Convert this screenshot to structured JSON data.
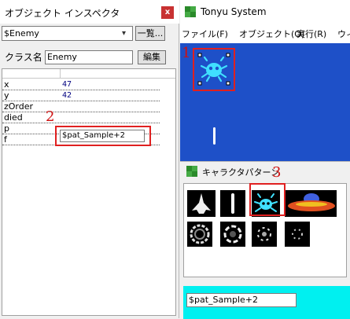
{
  "inspector": {
    "title": "オブジェクト インスペクタ",
    "close_label": "x",
    "object_select_value": "$Enemy",
    "list_button": "一覧...",
    "class_label": "クラス名",
    "class_value": "Enemy",
    "edit_button": "編集",
    "properties": [
      {
        "name": "x",
        "value": "47"
      },
      {
        "name": "y",
        "value": "42"
      },
      {
        "name": "zOrder",
        "value": ""
      },
      {
        "name": "died",
        "value": ""
      },
      {
        "name": "p",
        "value": "$pat_Sample+2"
      },
      {
        "name": "f",
        "value": ""
      }
    ]
  },
  "tonyu": {
    "title": "Tonyu System",
    "menu": [
      {
        "label": "ファイル(F)"
      },
      {
        "label": "オブジェクト(O)"
      },
      {
        "label": "実行(R)"
      },
      {
        "label": "ウィ"
      }
    ]
  },
  "pattern_panel": {
    "title": "キャラクタパターン",
    "selected_value": "$pat_Sample+2"
  },
  "annotations": {
    "step1": "1",
    "step2": "2",
    "step3": "3"
  },
  "colors": {
    "stage_bg": "#1e50c8",
    "highlight": "#e02020",
    "pattern_bar": "#00f0f0"
  }
}
